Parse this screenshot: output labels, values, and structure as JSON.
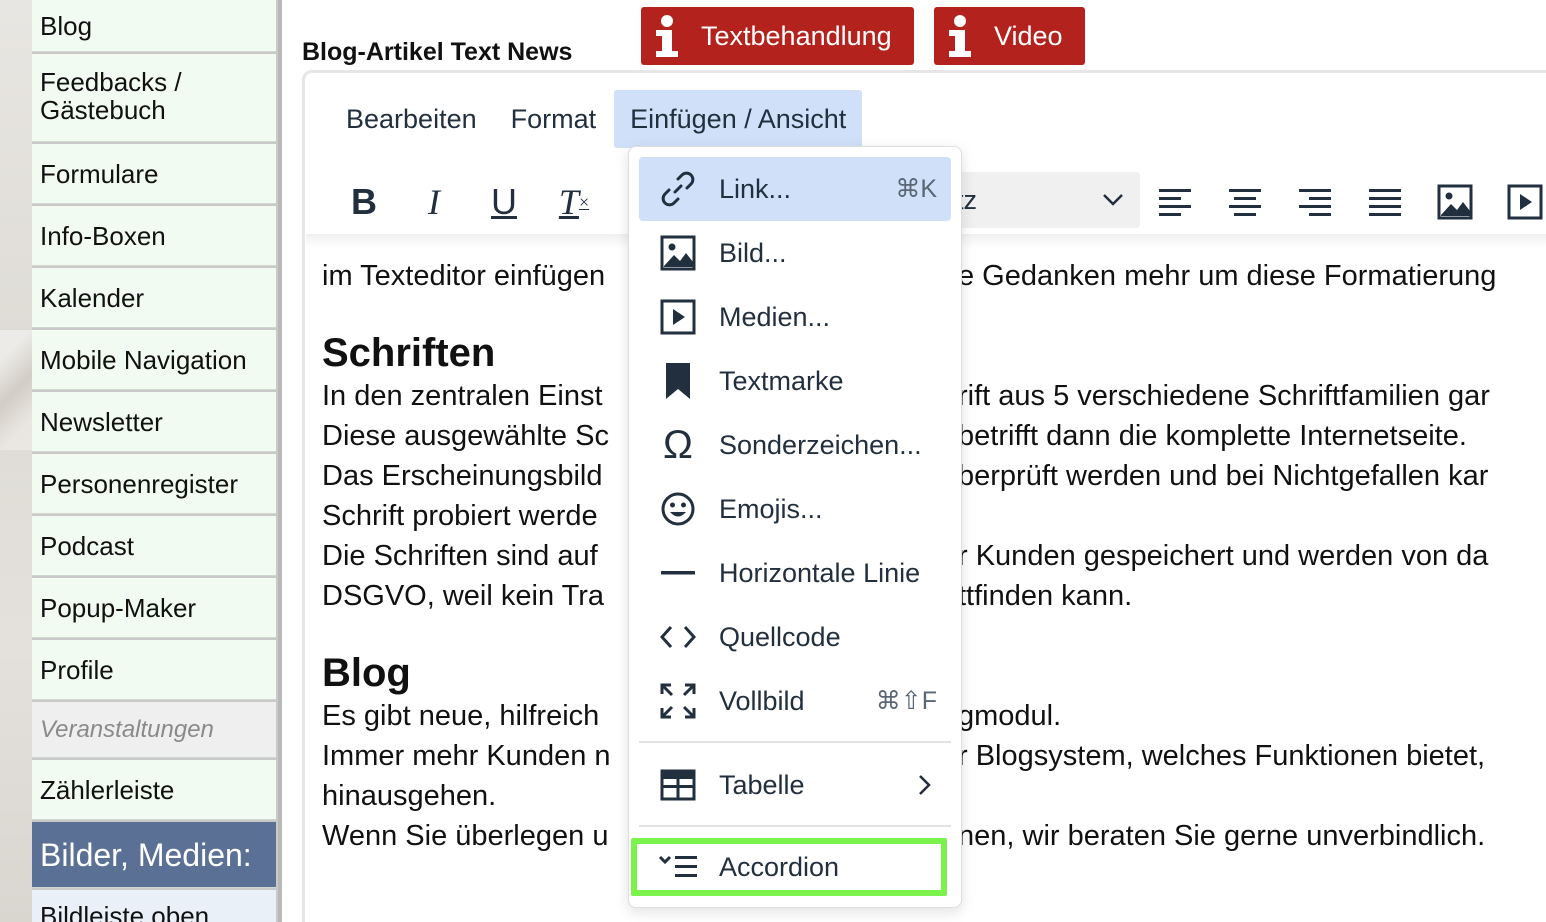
{
  "sidebar": {
    "items": [
      {
        "label": "Blog"
      },
      {
        "label": "Feedbacks / Gästebuch"
      },
      {
        "label": "Formulare"
      },
      {
        "label": "Info-Boxen"
      },
      {
        "label": "Kalender"
      },
      {
        "label": "Mobile Navigation"
      },
      {
        "label": "Newsletter"
      },
      {
        "label": "Personenregister"
      },
      {
        "label": "Podcast"
      },
      {
        "label": "Popup-Maker"
      },
      {
        "label": "Profile"
      },
      {
        "label": "Veranstaltungen"
      },
      {
        "label": "Zählerleiste"
      },
      {
        "label": "Bilder, Medien:"
      },
      {
        "label": "Bildleiste oben"
      }
    ]
  },
  "header": {
    "title": "Blog-Artikel Text News",
    "info_buttons": [
      {
        "label": "Textbehandlung",
        "color": "#b3221d"
      },
      {
        "label": "Video",
        "color": "#b3221d"
      }
    ]
  },
  "editor": {
    "menubar": [
      "Bearbeiten",
      "Format",
      "Einfügen / Ansicht"
    ],
    "toolbar": {
      "bold": "B",
      "italic": "I",
      "underline": "U",
      "clear_format": "T",
      "font_select_partial": "tz"
    },
    "content": {
      "line1_left": "im Texteditor einfügen",
      "line1_right": "e Gedanken mehr um diese Formatierung",
      "h_schriften": "Schriften",
      "schriften_lines": [
        {
          "left": "In den zentralen Einst",
          "right": "rift aus 5 verschiedene Schriftfamilien gar"
        },
        {
          "left": "Diese ausgewählte Sc",
          "right": "betrifft dann die komplette Internetseite."
        },
        {
          "left": "Das Erscheinungsbild",
          "right": "berprüft werden und bei Nichtgefallen kar"
        },
        {
          "left": "Schrift probiert werde",
          "right": ""
        },
        {
          "left": "Die Schriften sind auf",
          "right": "r Kunden gespeichert und werden von da"
        },
        {
          "left": "DSGVO, weil kein Tra",
          "right": "ttfinden kann."
        }
      ],
      "h_blog": "Blog",
      "blog_lines": [
        {
          "left": "Es gibt neue, hilfreich",
          "right": "gmodul."
        },
        {
          "left": "Immer mehr Kunden n",
          "right": "r Blogsystem, welches Funktionen bietet,"
        },
        {
          "left": "hinausgehen.",
          "right": ""
        },
        {
          "left": "Wenn Sie überlegen u",
          "right": "nen, wir beraten Sie gerne unverbindlich."
        }
      ]
    }
  },
  "dropdown": {
    "items": [
      {
        "label": "Link...",
        "shortcut": "⌘K",
        "icon": "link-icon"
      },
      {
        "label": "Bild...",
        "shortcut": "",
        "icon": "image-icon"
      },
      {
        "label": "Medien...",
        "shortcut": "",
        "icon": "media-icon"
      },
      {
        "label": "Textmarke",
        "shortcut": "",
        "icon": "bookmark-icon"
      },
      {
        "label": "Sonderzeichen...",
        "shortcut": "",
        "icon": "omega-icon"
      },
      {
        "label": "Emojis...",
        "shortcut": "",
        "icon": "emoji-icon"
      },
      {
        "label": "Horizontale Linie",
        "shortcut": "",
        "icon": "horizontal-line-icon"
      },
      {
        "label": "Quellcode",
        "shortcut": "",
        "icon": "code-icon"
      },
      {
        "label": "Vollbild",
        "shortcut": "⌘⇧F",
        "icon": "fullscreen-icon"
      },
      {
        "label": "Tabelle",
        "shortcut": "",
        "icon": "table-icon"
      },
      {
        "label": "Accordion",
        "shortcut": "",
        "icon": "accordion-icon"
      }
    ],
    "highlight_color": "#7cf24c"
  }
}
